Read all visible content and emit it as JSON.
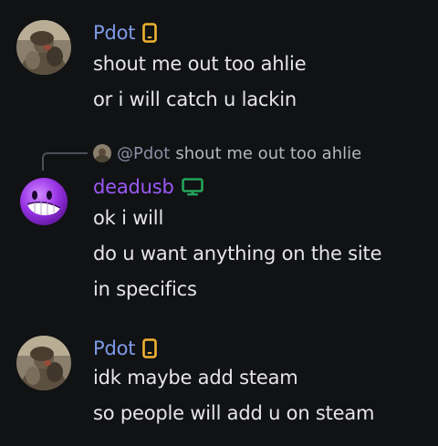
{
  "messages": [
    {
      "author": "Pdot",
      "device": "mobile-icon",
      "lines": [
        "shout me out too ahlie",
        "or i will catch u lackin"
      ]
    },
    {
      "author": "deadusb",
      "device": "desktop-icon",
      "reply": {
        "mention": "@Pdot",
        "text": "shout me out too ahlie"
      },
      "lines": [
        "ok i will",
        "do u want anything on the site",
        "in specifics"
      ]
    },
    {
      "author": "Pdot",
      "device": "mobile-icon",
      "lines": [
        "idk maybe add steam",
        "so people will add u on steam"
      ]
    }
  ],
  "colors": {
    "background": "#111214",
    "pdot_name": "#7e9be8",
    "deadusb_name": "#9b59f6",
    "mobile_icon": "#f0b232",
    "desktop_icon": "#23a55a"
  }
}
